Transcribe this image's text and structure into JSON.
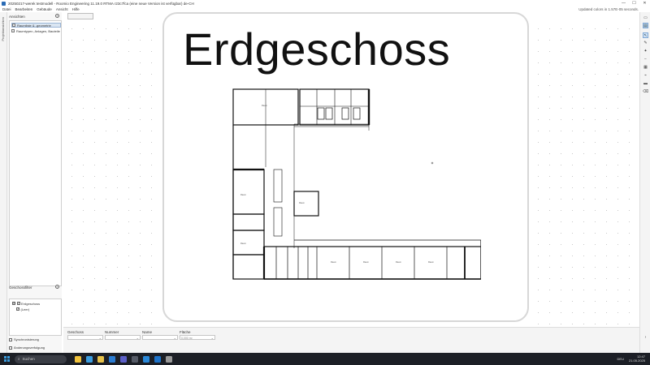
{
  "window": {
    "title": "20250217-werek testmodell - Roomio Engineering 11.19.0 RTMA r23c7fca (eine neue Version ist verfügbar) de-CH",
    "controls": [
      "—",
      "☐",
      "✕"
    ]
  },
  "menu": {
    "items": [
      "Datei",
      "Bearbeiten",
      "Gebäude",
      "Ansicht",
      "Hilfe"
    ],
    "status": "Updated colors in 1.57E-05 seconds."
  },
  "left_rail": {
    "label": "Projektansichten"
  },
  "views_panel": {
    "header": "Ansichten",
    "add_symbol": "+",
    "items": [
      {
        "label": "Raumliste & -geometrie",
        "selected": true
      },
      {
        "label": "Raumtypen, Anlagen, Bauteile",
        "selected": false
      }
    ]
  },
  "floors_panel": {
    "header": "Geschossfilter",
    "add_symbol": "+",
    "items": [
      {
        "label": "Erdgeschoss",
        "checked": true
      },
      {
        "label": "(Leer)",
        "checked": true
      }
    ]
  },
  "checkboxes": {
    "synchronisation": "Synchronisierung",
    "tracking": "Änderungsverfolgung"
  },
  "main": {
    "plan_title": "Erdgeschoss"
  },
  "bottom_filters": [
    {
      "label": "Geschoss",
      "value": ""
    },
    {
      "label": "Nummer",
      "value": ""
    },
    {
      "label": "Name",
      "value": ""
    },
    {
      "label": "Fläche",
      "value": "0,000 m²"
    }
  ],
  "right_tools": [
    "save-icon",
    "layers-icon",
    "cursor-icon",
    "pencil-icon",
    "wrench-icon",
    "minus-icon",
    "grid-icon",
    "chart-icon",
    "keyboard-icon",
    "trash-icon"
  ],
  "taskbar": {
    "search_placeholder": "Suchen",
    "apps": [
      {
        "name": "file-explorer",
        "color": "#f0c23c"
      },
      {
        "name": "browser",
        "color": "#3b9de0"
      },
      {
        "name": "chrome",
        "color": "#e8c24a"
      },
      {
        "name": "mail",
        "color": "#2a7bd1"
      },
      {
        "name": "teams",
        "color": "#5b5fc7"
      },
      {
        "name": "settings",
        "color": "#555a66"
      },
      {
        "name": "vscode",
        "color": "#2a88d8"
      },
      {
        "name": "app-blue",
        "color": "#1e73c9"
      },
      {
        "name": "roomio",
        "color": "#999999"
      }
    ],
    "language": "DEU",
    "time": "12:47",
    "date": "21.05.2025"
  }
}
